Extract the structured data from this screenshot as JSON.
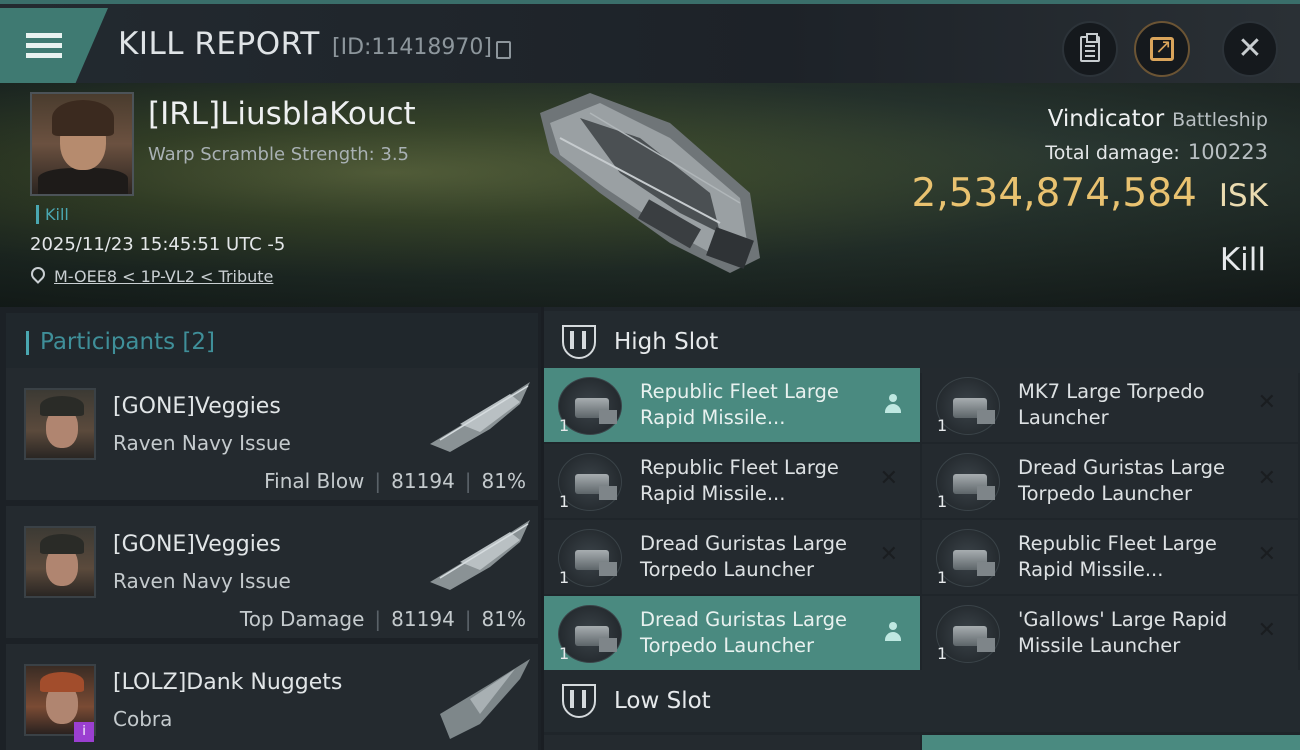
{
  "header": {
    "title": "KILL REPORT",
    "report_id": "[ID:11418970]"
  },
  "victim": {
    "name": "[IRL]LiusblaKouct",
    "warp_scramble": "Warp Scramble Strength: 3.5",
    "tag": "Kill",
    "datetime": "2025/11/23 15:45:51 UTC -5",
    "location": "M-OEE8 < 1P-VL2 < Tribute",
    "ship": "Vindicator",
    "ship_class": "Battleship",
    "total_damage_label": "Total damage:",
    "total_damage": "100223",
    "isk_value": "2,534,874,584",
    "isk_unit": "ISK",
    "result": "Kill"
  },
  "participants": {
    "label": "Participants",
    "count": "[2]",
    "rows": [
      {
        "name": "[GONE]Veggies",
        "ship": "Raven Navy Issue",
        "stat_label": "Final Blow",
        "damage": "81194",
        "percent": "81%"
      },
      {
        "name": "[GONE]Veggies",
        "ship": "Raven Navy Issue",
        "stat_label": "Top Damage",
        "damage": "81194",
        "percent": "81%"
      },
      {
        "name": "[LOLZ]Dank Nuggets",
        "ship": "Cobra",
        "badge": "i"
      }
    ]
  },
  "fitting": {
    "high_slot_label": "High Slot",
    "low_slot_label": "Low Slot",
    "high_slots": [
      {
        "line1": "Republic Fleet Large",
        "line2": "Rapid Missile...",
        "qty": "1",
        "status": "person"
      },
      {
        "line1": "MK7 Large Torpedo",
        "line2": "Launcher",
        "qty": "1",
        "status": "x"
      },
      {
        "line1": "Republic Fleet Large",
        "line2": "Rapid Missile...",
        "qty": "1",
        "status": "x"
      },
      {
        "line1": "Dread Guristas Large",
        "line2": "Torpedo Launcher",
        "qty": "1",
        "status": "x"
      },
      {
        "line1": "Dread Guristas Large",
        "line2": "Torpedo Launcher",
        "qty": "1",
        "status": "x"
      },
      {
        "line1": "Republic Fleet Large",
        "line2": "Rapid Missile...",
        "qty": "1",
        "status": "x"
      },
      {
        "line1": "Dread Guristas Large",
        "line2": "Torpedo Launcher",
        "qty": "1",
        "status": "person"
      },
      {
        "line1": "'Gallows' Large Rapid",
        "line2": "Missile Launcher",
        "qty": "1",
        "status": "x"
      }
    ]
  },
  "colors": {
    "accent_teal": "#4a8a80",
    "isk_gold": "#e9c270",
    "link_teal": "#4aa7b1"
  }
}
